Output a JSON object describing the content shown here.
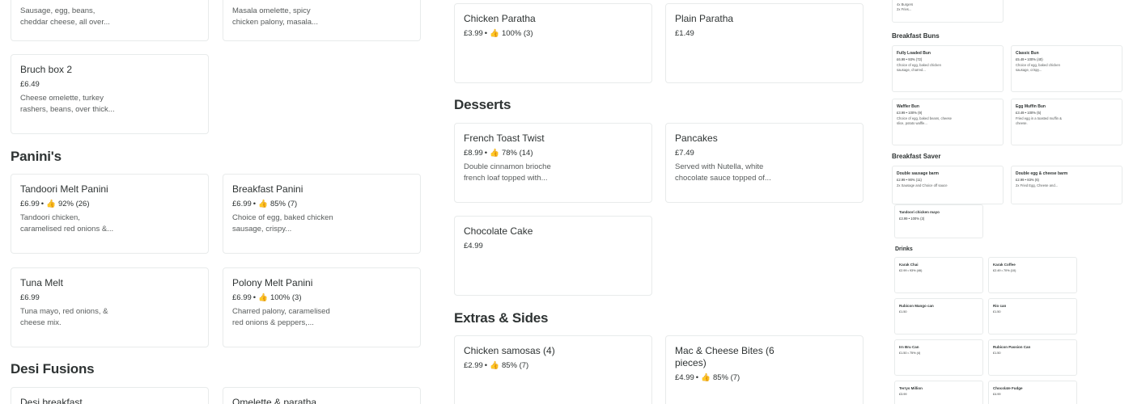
{
  "sections": {
    "paninis": "Panini's",
    "desi": "Desi Fusions",
    "desserts": "Desserts",
    "extras": "Extras & Sides"
  },
  "items": {
    "top_left_a": {
      "desc": "Sausage, egg, beans, cheddar cheese, all over..."
    },
    "top_left_b": {
      "desc": "Masala omelette, spicy chicken palony, masala..."
    },
    "bruch_box_2": {
      "name": "Bruch box 2",
      "price": "£6.49",
      "desc": "Cheese omelette, turkey rashers, beans, over thick..."
    },
    "tandoori_melt": {
      "name": "Tandoori Melt Panini",
      "price": "£6.99",
      "rating": "92% (26)",
      "desc": "Tandoori chicken, caramelised red onions &..."
    },
    "breakfast_panini": {
      "name": "Breakfast Panini",
      "price": "£6.99",
      "rating": "85% (7)",
      "desc": "Choice of egg, baked chicken sausage, crispy..."
    },
    "tuna_melt": {
      "name": "Tuna Melt",
      "price": "£6.99",
      "desc": "Tuna mayo, red onions, & cheese mix."
    },
    "polony_melt": {
      "name": "Polony Melt Panini",
      "price": "£6.99",
      "rating": "100% (3)",
      "desc": "Charred palony, caramelised red onions & peppers,..."
    },
    "desi_breakfast": {
      "name": "Desi breakfast"
    },
    "omelette_paratha": {
      "name": "Omelette & paratha"
    },
    "chicken_paratha": {
      "name": "Chicken Paratha",
      "price": "£3.99",
      "rating": "100% (3)"
    },
    "plain_paratha": {
      "name": "Plain Paratha",
      "price": "£1.49"
    },
    "french_toast": {
      "name": "French Toast Twist",
      "price": "£8.99",
      "rating": "78% (14)",
      "desc": "Double cinnamon brioche french loaf topped with..."
    },
    "pancakes": {
      "name": "Pancakes",
      "price": "£7.49",
      "desc": "Served with Nutella, white chocolate sauce topped of..."
    },
    "chocolate_cake": {
      "name": "Chocolate Cake",
      "price": "£4.99"
    },
    "chicken_samosas": {
      "name": "Chicken samosas (4)",
      "price": "£2.99",
      "rating": "85% (7)"
    },
    "mac_cheese": {
      "name": "Mac & Cheese Bites (6 pieces)",
      "price": "£4.99",
      "rating": "85% (7)"
    }
  },
  "right": {
    "top_card": {
      "line1": "4x Burgers",
      "line2": "2x Fries..."
    },
    "breakfast_buns": "Breakfast Buns",
    "buns": [
      {
        "name": "Fully Loaded Bun",
        "meta": "£6.99 • 93% (72)",
        "desc": "Choice of egg, baked chicken sausage, charred..."
      },
      {
        "name": "Classic Bun",
        "meta": "£5.49 • 100% (40)",
        "desc": "Choice of egg, baked chicken sausage, crispy..."
      },
      {
        "name": "Waffler Bun",
        "meta": "£3.99 • 100% (9)",
        "desc": "Choice of egg, baked beans, cheese slice, potato waffle..."
      },
      {
        "name": "Egg Muffin Bun",
        "meta": "£3.49 • 100% (5)",
        "desc": "Fried egg in a toasted muffin & cheese."
      }
    ],
    "breakfast_saver": "Breakfast Saver",
    "saver": [
      {
        "name": "Double sausage barm",
        "meta": "£2.99 • 90% (11)",
        "desc": "2x Sausage and Choice off sauce"
      },
      {
        "name": "Double egg & cheese barm",
        "meta": "£2.99 • 83% (6)",
        "desc": "2x Fried Egg, Cheese and..."
      },
      {
        "name": "Tandoori chicken mayo",
        "meta": "£3.99 • 100% (3)",
        "desc": ""
      }
    ],
    "drinks": "Drinks",
    "drink_items": [
      {
        "name": "Karak Chai",
        "meta": "£2.99 • 93% (46)"
      },
      {
        "name": "Karak Coffee",
        "meta": "£2.49 • 70% (10)"
      },
      {
        "name": "Rubicon Mango can",
        "meta": "£1.50"
      },
      {
        "name": "Rio can",
        "meta": "£1.50"
      },
      {
        "name": "Irn Bru Can",
        "meta": "£1.50 • 75% (4)"
      },
      {
        "name": "Rubicon Passion Can",
        "meta": "£1.50"
      },
      {
        "name": "Terrys Million",
        "meta": "£3.99"
      },
      {
        "name": "Chocolate Fudge",
        "meta": "£4.99"
      }
    ]
  }
}
